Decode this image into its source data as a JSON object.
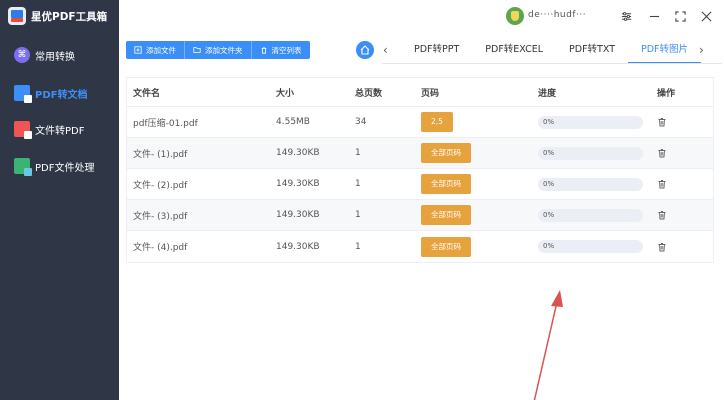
{
  "app": {
    "title": "星优PDF工具箱"
  },
  "sidebar": {
    "items": [
      {
        "label": "常用转换",
        "icon": "grid-icon",
        "active": false
      },
      {
        "label": "PDF转文档",
        "icon": "pdf-doc-icon",
        "active": true
      },
      {
        "label": "文件转PDF",
        "icon": "file-to-pdf-icon",
        "active": false
      },
      {
        "label": "PDF文件处理",
        "icon": "pdf-process-icon",
        "active": false
      }
    ]
  },
  "header": {
    "user_name": "de····hudf···"
  },
  "toolbar": {
    "add_file": "添加文件",
    "add_folder": "添加文件夹",
    "clear_list": "清空列表"
  },
  "tabs": [
    {
      "label": "PDF转PPT",
      "active": false
    },
    {
      "label": "PDF转EXCEL",
      "active": false
    },
    {
      "label": "PDF转TXT",
      "active": false
    },
    {
      "label": "PDF转图片",
      "active": true
    }
  ],
  "table": {
    "columns": [
      "文件名",
      "大小",
      "总页数",
      "页码",
      "进度",
      "操作"
    ],
    "rows": [
      {
        "name": "pdf压缩-01.pdf",
        "size": "4.55MB",
        "pages": "34",
        "page_range": "2,5",
        "progress": "0%",
        "progress_value": 0
      },
      {
        "name": "文件- (1).pdf",
        "size": "149.30KB",
        "pages": "1",
        "page_range": "全部页码",
        "progress": "0%",
        "progress_value": 0
      },
      {
        "name": "文件- (2).pdf",
        "size": "149.30KB",
        "pages": "1",
        "page_range": "全部页码",
        "progress": "0%",
        "progress_value": 0
      },
      {
        "name": "文件- (3).pdf",
        "size": "149.30KB",
        "pages": "1",
        "page_range": "全部页码",
        "progress": "0%",
        "progress_value": 0
      },
      {
        "name": "文件- (4).pdf",
        "size": "149.30KB",
        "pages": "1",
        "page_range": "全部页码",
        "progress": "0%",
        "progress_value": 0
      }
    ]
  },
  "colors": {
    "sidebar_bg": "#2f3646",
    "accent": "#3a8ef6",
    "page_button": "#e6a23c",
    "annotation_arrow": "#d9534f"
  }
}
